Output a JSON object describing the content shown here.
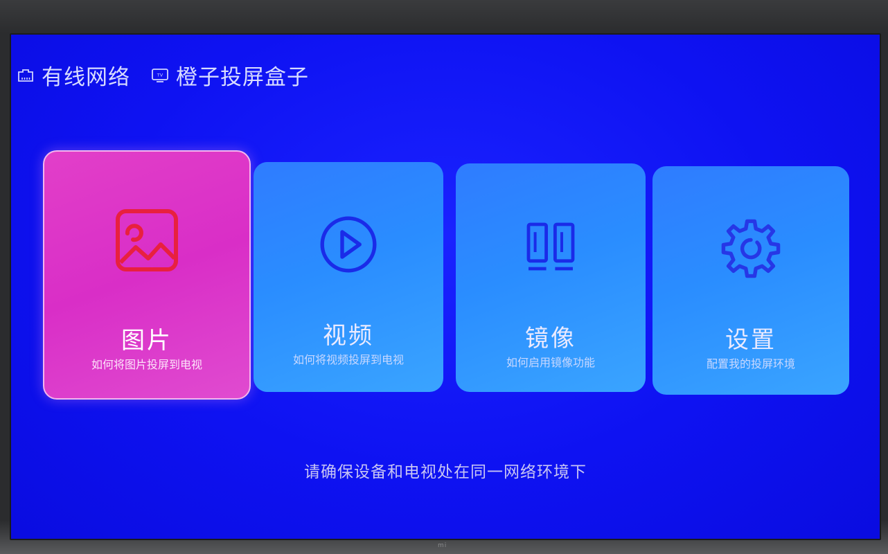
{
  "status_bar": {
    "network": {
      "icon": "ethernet-icon",
      "label": "有线网络"
    },
    "device": {
      "icon": "tv-icon",
      "icon_text": "TV",
      "label": "橙子投屏盒子"
    }
  },
  "cards": [
    {
      "key": "photos",
      "icon": "image-icon",
      "title": "图片",
      "subtitle": "如何将图片投屏到电视",
      "selected": true
    },
    {
      "key": "video",
      "icon": "play-icon",
      "title": "视频",
      "subtitle": "如何将视频投屏到电视",
      "selected": false
    },
    {
      "key": "mirror",
      "icon": "mirror-icon",
      "title": "镜像",
      "subtitle": "如何启用镜像功能",
      "selected": false
    },
    {
      "key": "settings",
      "icon": "gear-icon",
      "title": "设置",
      "subtitle": "配置我的投屏环境",
      "selected": false
    }
  ],
  "hint": "请确保设备和电视处在同一网络环境下",
  "bezel_logo": "mi",
  "colors": {
    "screen_bg": "#0e12f2",
    "card_blue": "#2a8dff",
    "card_selected": "#d92ec7",
    "icon_selected": "#e8203f",
    "icon_blue": "#1a2be8"
  }
}
